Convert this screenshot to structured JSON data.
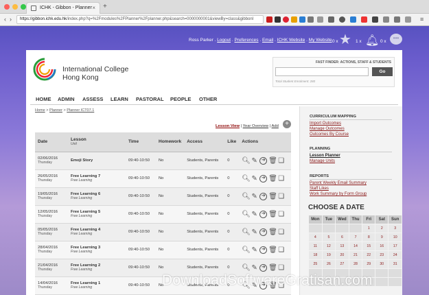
{
  "browser": {
    "tab_title": "ICHK - Gibbon - Planner",
    "tab_close": "×",
    "new_tab": "+",
    "url_host": "https://gibbon.ichk.edu.hk",
    "url_path": "/index.php?q=%2Fmodules%2FPlanner%2Fplanner.php&search=0000000001&viewBy=class&gibbonI"
  },
  "userbar": {
    "name": "Ross Parker",
    "links": [
      "Logout",
      "Preferences",
      "Email",
      "ICHK Website",
      "My Website"
    ],
    "sep": " . ",
    "counts": [
      "0 x",
      "1 x",
      "0 x"
    ]
  },
  "header": {
    "school_line1": "International College",
    "school_line2": "Hong Kong",
    "finder_title": "FAST FINDER: ACTIONS, STAFF & STUDENTS",
    "finder_placeholder": "",
    "finder_button": "Go",
    "finder_note": "Total Student Enrolment: 280"
  },
  "nav": [
    "HOME",
    "ADMIN",
    "ASSESS",
    "LEARN",
    "PASTORAL",
    "PEOPLE",
    "OTHER"
  ],
  "breadcrumb": [
    "Home",
    "Planner",
    "Planner ICT07.1"
  ],
  "views": {
    "lesson_view": "Lesson View",
    "year_overview": "Year Overview",
    "add": "Add",
    "sep": " | ",
    "add_icon": "+"
  },
  "table": {
    "headers": {
      "date": "Date",
      "lesson": "Lesson",
      "unit": "Unit",
      "time": "Time",
      "homework": "Homework",
      "access": "Access",
      "like": "Like",
      "actions": "Actions"
    },
    "rows": [
      {
        "date": "02/06/2016",
        "day": "Thursday",
        "lesson": "Emoji Story",
        "unit": "",
        "time": "09:40-10:50",
        "homework": "No",
        "access": "Students, Parents",
        "like": "0"
      },
      {
        "date": "26/05/2016",
        "day": "Thursday",
        "lesson": "Free Learning 7",
        "unit": "Free Learning",
        "time": "09:40-10:50",
        "homework": "No",
        "access": "Students, Parents",
        "like": "0"
      },
      {
        "date": "19/05/2016",
        "day": "Thursday",
        "lesson": "Free Learning 6",
        "unit": "Free Learning",
        "time": "09:40-10:50",
        "homework": "No",
        "access": "Students, Parents",
        "like": "0"
      },
      {
        "date": "12/05/2016",
        "day": "Thursday",
        "lesson": "Free Learning 5",
        "unit": "Free Learning",
        "time": "09:40-10:50",
        "homework": "No",
        "access": "Students, Parents",
        "like": "0"
      },
      {
        "date": "05/05/2016",
        "day": "Thursday",
        "lesson": "Free Learning 4",
        "unit": "Free Learning",
        "time": "09:40-10:50",
        "homework": "No",
        "access": "Students, Parents",
        "like": "0"
      },
      {
        "date": "28/04/2016",
        "day": "Thursday",
        "lesson": "Free Learning 3",
        "unit": "Free Learning",
        "time": "09:40-10:50",
        "homework": "No",
        "access": "Students, Parents",
        "like": "0"
      },
      {
        "date": "21/04/2016",
        "day": "Thursday",
        "lesson": "Free Learning 2",
        "unit": "Free Learning",
        "time": "09:40-10:50",
        "homework": "No",
        "access": "Students, Parents",
        "like": "0"
      },
      {
        "date": "14/04/2016",
        "day": "Thursday",
        "lesson": "Free Learning 1",
        "unit": "Free Learning",
        "time": "09:40-10:50",
        "homework": "No",
        "access": "Students, Parents",
        "like": "0"
      }
    ]
  },
  "sidebar": {
    "curriculum_title": "CURRICULUM MAPPING",
    "curriculum_links": [
      "Import Outcomes",
      "Manage Outcomes",
      "Outcomes By Course"
    ],
    "planning_title": "PLANNING",
    "planning_links": [
      "Lesson Planner",
      "Manage Units"
    ],
    "reports_title": "REPORTS",
    "reports_links": [
      "Parent Weekly Email Summary",
      "Staff Likes",
      "Work Summary by Form Group"
    ],
    "calendar_title": "CHOOSE A DATE",
    "days": [
      "Mon",
      "Tue",
      "Wed",
      "Thu",
      "Fri",
      "Sat",
      "Sun"
    ],
    "weeks": [
      [
        "",
        "",
        "",
        "",
        "1",
        "2",
        "3"
      ],
      [
        "4",
        "5",
        "6",
        "7",
        "8",
        "9",
        "10"
      ],
      [
        "11",
        "12",
        "13",
        "14",
        "15",
        "16",
        "17"
      ],
      [
        "18",
        "19",
        "20",
        "21",
        "22",
        "23",
        "24"
      ],
      [
        "25",
        "26",
        "27",
        "28",
        "29",
        "30",
        "31"
      ],
      [
        "",
        "",
        "",
        "",
        "",
        "",
        ""
      ],
      [
        "",
        "",
        "",
        "",
        "",
        "",
        ""
      ]
    ]
  },
  "watermark": "DownloadSoftwareGratisan.com",
  "colors": {
    "link": "#8b1a1a",
    "accent": "#4a4ab8",
    "table_header": "#dddddd"
  }
}
